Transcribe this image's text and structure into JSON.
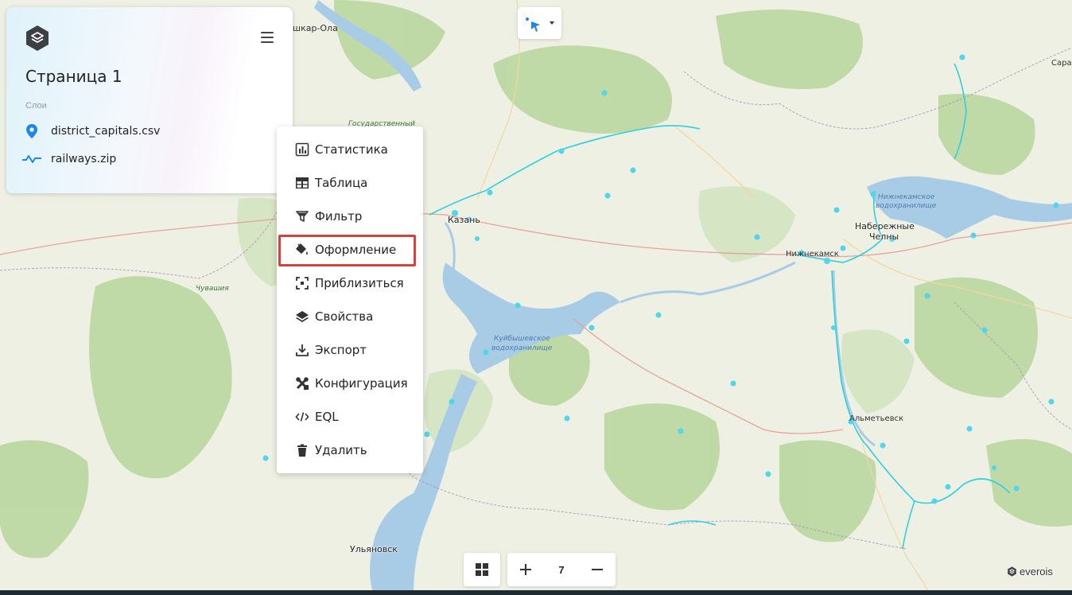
{
  "panel": {
    "page_title": "Страница 1",
    "layers_label": "Слои",
    "layers": [
      {
        "name": "district_capitals.csv",
        "icon": "map-pin-icon"
      },
      {
        "name": "railways.zip",
        "icon": "line-layer-icon"
      }
    ]
  },
  "context_menu": {
    "items": [
      {
        "label": "Статистика",
        "icon": "chart-icon"
      },
      {
        "label": "Таблица",
        "icon": "table-icon"
      },
      {
        "label": "Фильтр",
        "icon": "filter-icon"
      },
      {
        "label": "Оформление",
        "icon": "paint-bucket-icon",
        "highlighted": true
      },
      {
        "label": "Приблизиться",
        "icon": "zoom-to-icon"
      },
      {
        "label": "Свойства",
        "icon": "layers-icon"
      },
      {
        "label": "Экспорт",
        "icon": "download-icon"
      },
      {
        "label": "Конфигурация",
        "icon": "tools-icon"
      },
      {
        "label": "EQL",
        "icon": "code-icon"
      },
      {
        "label": "Удалить",
        "icon": "trash-icon"
      }
    ]
  },
  "map": {
    "labels": {
      "yoshkar_ola": "шкар-Ола",
      "kazan": "Казань",
      "ulyanovsk": "Ульяновск",
      "nizhnekamsk": "Нижнекамск",
      "naberezhnye_1": "Набережные",
      "naberezhnye_2": "Челны",
      "almetyevsk": "Альметьевск",
      "saransk_edge": "Сарап",
      "chuvashia": "Чувашия",
      "gos": "Государственный",
      "kuib_1": "Куйбышевское",
      "kuib_2": "водохранилище",
      "nizhnekam_res_1": "Нижнекамское",
      "nizhnekam_res_2": "водохранилище"
    }
  },
  "zoom": {
    "level": "7"
  },
  "brand": {
    "name": "everois"
  },
  "colors": {
    "accent": "#1e88e5",
    "highlight": "#d0443c",
    "railway": "#2fd0e0",
    "water": "#a9cce6"
  }
}
